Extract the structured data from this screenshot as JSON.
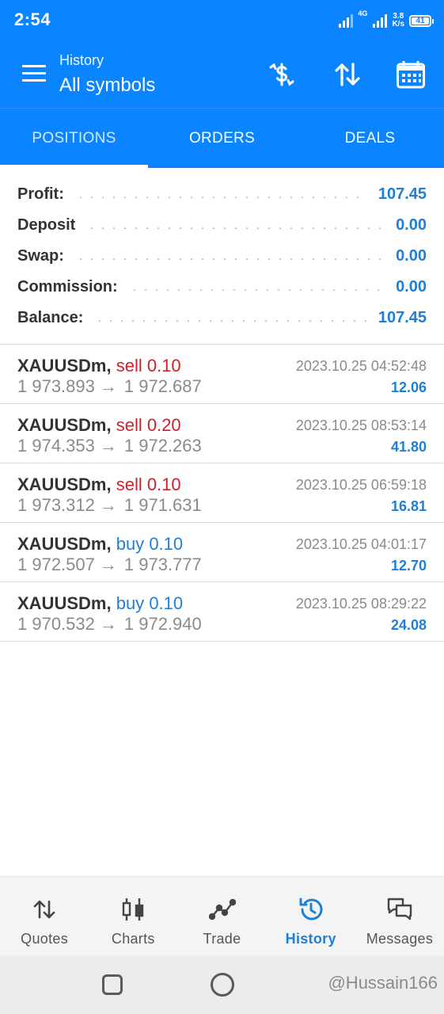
{
  "status_bar": {
    "time": "2:54",
    "network_label": "4G",
    "speed_top": "3.8",
    "speed_bottom": "K/s",
    "battery": "41"
  },
  "app_bar": {
    "subtitle": "History",
    "title": "All symbols",
    "icons": [
      "menu-icon",
      "currency-icon",
      "sort-icon",
      "calendar-icon"
    ]
  },
  "tabs": [
    {
      "label": "POSITIONS",
      "active": true
    },
    {
      "label": "ORDERS",
      "active": false
    },
    {
      "label": "DEALS",
      "active": false
    }
  ],
  "summary": [
    {
      "label": "Profit:",
      "value": "107.45"
    },
    {
      "label": "Deposit",
      "value": "0.00"
    },
    {
      "label": "Swap:",
      "value": "0.00"
    },
    {
      "label": "Commission:",
      "value": "0.00"
    },
    {
      "label": "Balance:",
      "value": "107.45"
    }
  ],
  "positions": [
    {
      "symbol": "XAUUSDm,",
      "side": "sell",
      "volume": "0.10",
      "time": "2023.10.25 04:52:48",
      "open": "1 973.893",
      "close": "1 972.687",
      "arrow": "→",
      "profit": "12.06"
    },
    {
      "symbol": "XAUUSDm,",
      "side": "sell",
      "volume": "0.20",
      "time": "2023.10.25 08:53:14",
      "open": "1 974.353",
      "close": "1 972.263",
      "arrow": "→",
      "profit": "41.80"
    },
    {
      "symbol": "XAUUSDm,",
      "side": "sell",
      "volume": "0.10",
      "time": "2023.10.25 06:59:18",
      "open": "1 973.312",
      "close": "1 971.631",
      "arrow": "→",
      "profit": "16.81"
    },
    {
      "symbol": "XAUUSDm,",
      "side": "buy",
      "volume": "0.10",
      "time": "2023.10.25 04:01:17",
      "open": "1 972.507",
      "close": "1 973.777",
      "arrow": "→",
      "profit": "12.70"
    },
    {
      "symbol": "XAUUSDm,",
      "side": "buy",
      "volume": "0.10",
      "time": "2023.10.25 08:29:22",
      "open": "1 970.532",
      "close": "1 972.940",
      "arrow": "→",
      "profit": "24.08"
    }
  ],
  "bottom_nav": [
    {
      "label": "Quotes",
      "icon": "quotes-icon",
      "active": false
    },
    {
      "label": "Charts",
      "icon": "charts-icon",
      "active": false
    },
    {
      "label": "Trade",
      "icon": "trade-icon",
      "active": false
    },
    {
      "label": "History",
      "icon": "history-icon",
      "active": true
    },
    {
      "label": "Messages",
      "icon": "messages-icon",
      "active": false
    }
  ],
  "watermark": "@Hussain166",
  "colors": {
    "brand": "#0a84ff",
    "profit_blue": "#1e7fd6",
    "sell_red": "#d0202a"
  }
}
